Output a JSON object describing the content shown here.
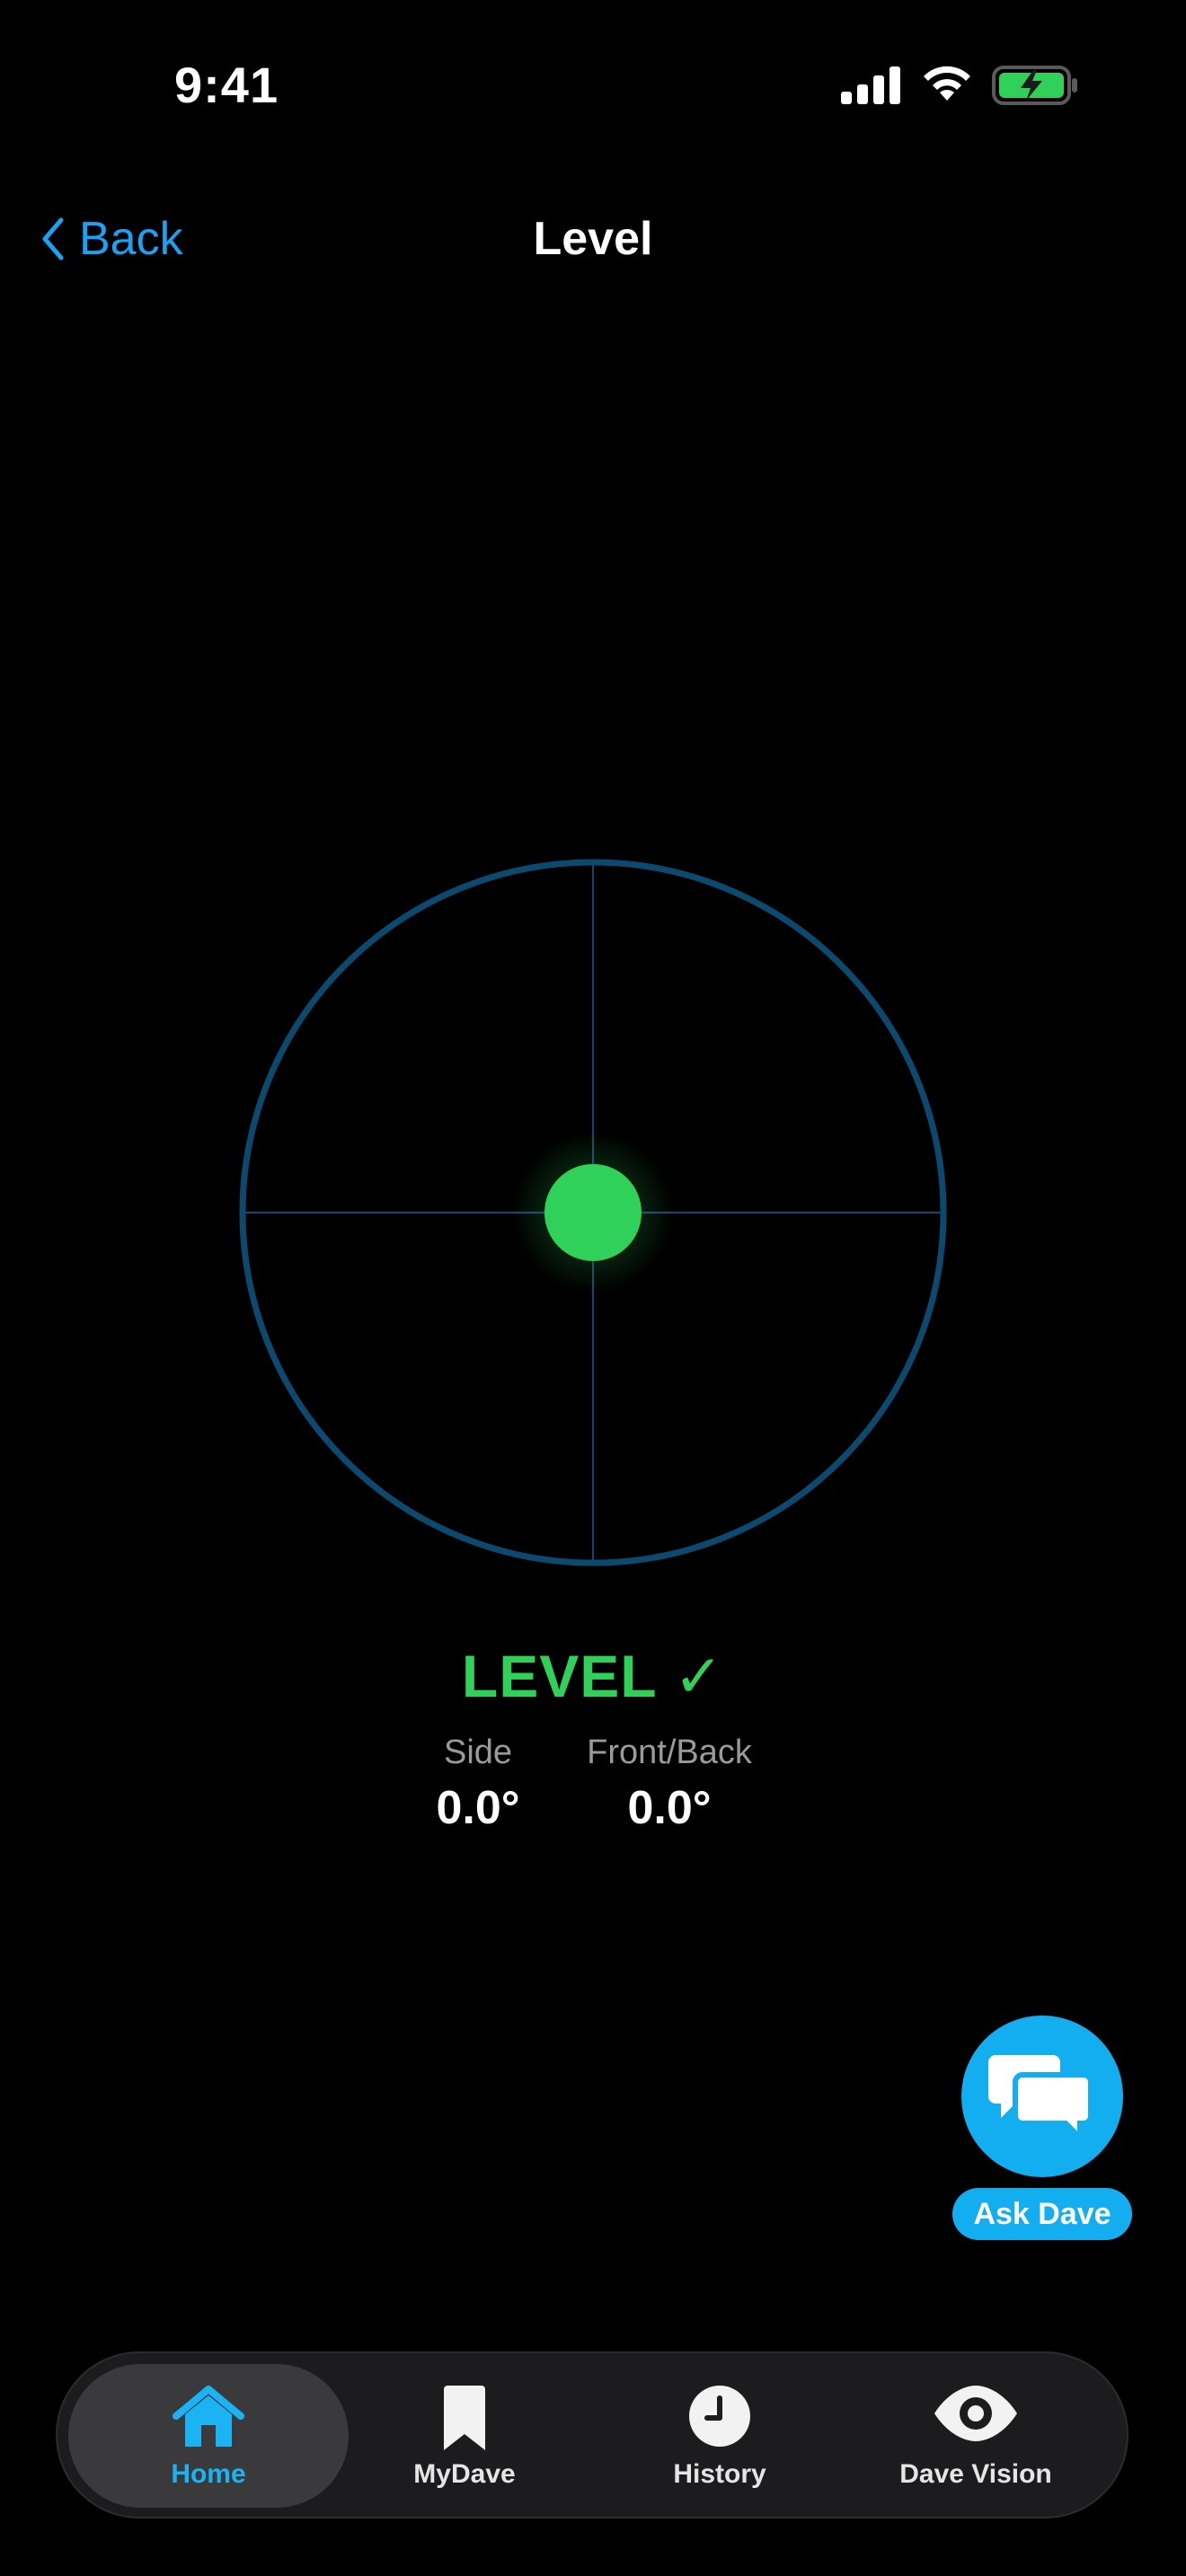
{
  "status_bar": {
    "time": "9:41",
    "icons": [
      "cellular-signal-icon",
      "wifi-icon",
      "battery-charging-icon"
    ]
  },
  "nav": {
    "back_label": "Back",
    "title": "Level"
  },
  "level": {
    "status": "LEVEL ✓",
    "bubble_x_deg": 0.0,
    "bubble_y_deg": 0.0,
    "readings": [
      {
        "label": "Side",
        "value": "0.0°"
      },
      {
        "label": "Front/Back",
        "value": "0.0°"
      }
    ]
  },
  "ask_dave": {
    "label": "Ask Dave",
    "icon": "chat-bubbles-icon"
  },
  "tab_bar": {
    "active": "Home",
    "tabs": [
      {
        "label": "Home",
        "icon": "home-icon"
      },
      {
        "label": "MyDave",
        "icon": "bookmark-icon"
      },
      {
        "label": "History",
        "icon": "clock-icon"
      },
      {
        "label": "Dave Vision",
        "icon": "eye-icon"
      }
    ]
  },
  "colors": {
    "accent_blue": "#1aa3f5",
    "level_green": "#30d158",
    "ring_blue": "#0b4a6e",
    "fab_blue": "#12aef0",
    "background": "#000000"
  }
}
